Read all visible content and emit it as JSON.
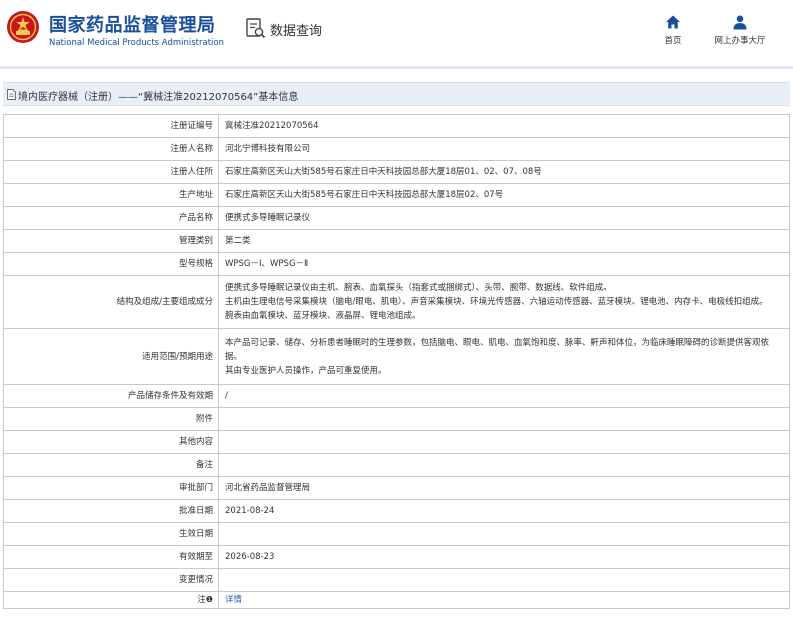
{
  "header": {
    "org_name_cn": "国家药品监督管理局",
    "org_name_en": "National Medical Products Administration",
    "query_title": "数据查询",
    "nav": [
      {
        "label": "首页",
        "icon": "home-icon"
      },
      {
        "label": "网上办事大厅",
        "icon": "user-icon"
      }
    ]
  },
  "colors": {
    "brand_blue": "#1a4f9c",
    "emblem_red": "#c8161d",
    "emblem_gold": "#f2c94c",
    "title_bar_bg": "#e9eff7",
    "link_blue": "#2a5db0"
  },
  "breadcrumb": {
    "text": "境内医疗器械（注册）——“冀械注准20212070564”基本信息"
  },
  "details": [
    {
      "label": "注册证编号",
      "lines": [
        "冀械注准20212070564"
      ]
    },
    {
      "label": "注册人名称",
      "lines": [
        "河北宁博科技有限公司"
      ]
    },
    {
      "label": "注册人住所",
      "lines": [
        "石家庄高新区天山大街585号石家庄日中天科技园总部大厦18层01、02、07、08号"
      ]
    },
    {
      "label": "生产地址",
      "lines": [
        "石家庄高新区天山大街585号石家庄日中天科技园总部大厦18层02、07号"
      ]
    },
    {
      "label": "产品名称",
      "lines": [
        "便携式多导睡眠记录仪"
      ]
    },
    {
      "label": "管理类别",
      "lines": [
        "第二类"
      ]
    },
    {
      "label": "型号规格",
      "lines": [
        "WPSG－Ⅰ、WPSG－Ⅱ"
      ]
    },
    {
      "label": "结构及组成/主要组成成分",
      "lines": [
        "便携式多导睡眠记录仪由主机、腕表、血氧探头（指套式或捆绑式）、头带、腕带、数据线、软件组成。",
        "主机由生理电信号采集模块（脑电/眼电、肌电）、声音采集模块、环境光传感器、六轴运动传感器、蓝牙模块、锂电池、内存卡、电极线扣组成。",
        "腕表由血氧模块、蓝牙模块、液晶屏、锂电池组成。"
      ]
    },
    {
      "label": "适用范围/预期用途",
      "lines": [
        "本产品可记录、储存、分析患者睡眠时的生理参数，包括脑电、眼电、肌电、血氧饱和度、脉率、鼾声和体位，为临床睡眠障碍的诊断提供客观依据。",
        "其由专业医护人员操作，产品可重复使用。"
      ]
    },
    {
      "label": "产品储存条件及有效期",
      "lines": [
        "/"
      ]
    },
    {
      "label": "附件",
      "lines": [
        ""
      ]
    },
    {
      "label": "其他内容",
      "lines": [
        ""
      ]
    },
    {
      "label": "备注",
      "lines": [
        ""
      ]
    },
    {
      "label": "审批部门",
      "lines": [
        "河北省药品监督管理局"
      ]
    },
    {
      "label": "批准日期",
      "lines": [
        "2021-08-24"
      ]
    },
    {
      "label": "生效日期",
      "lines": [
        ""
      ]
    },
    {
      "label": "有效期至",
      "lines": [
        "2026-08-23"
      ]
    },
    {
      "label": "变更情况",
      "lines": [
        ""
      ]
    },
    {
      "label": "注",
      "mark": "❶",
      "lines": [
        "详情"
      ],
      "link": true
    }
  ]
}
